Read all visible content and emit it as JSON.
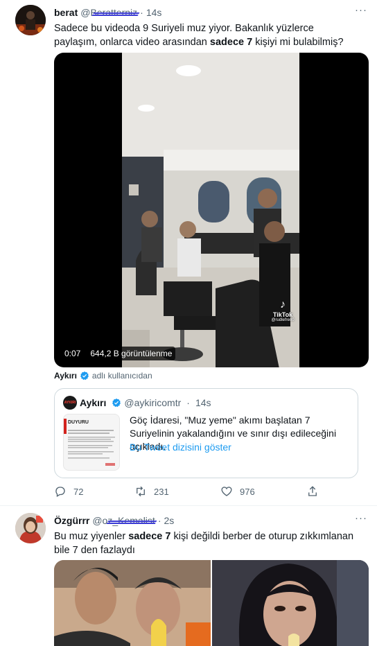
{
  "tweet1": {
    "name": "berat",
    "handle": "@Beratterniz",
    "dot": "·",
    "time": "14s",
    "more": "···",
    "text_part1": "Sadece bu videoda 9 Suriyeli muz yiyor. Bakanlık yüzlerce paylaşım, onlarca video arasından ",
    "text_bold": "sadece 7",
    "text_part2": " kişiyi mi bulabilmiş?",
    "video": {
      "time": "0:07",
      "views": "644,2 B görüntülenme",
      "tiktok_label": "TikTok",
      "tiktok_handle": "@rudlefren0"
    },
    "from_name": "Aykırı",
    "from_suffix": "adlı kullanıcıdan",
    "quote": {
      "avatar_text": "AYKIRI",
      "name": "Aykırı",
      "handle": "@aykiricomtr",
      "dot": "·",
      "time": "14s",
      "thumb_title": "DUYURU",
      "text": "Göç İdaresi, \"Muz yeme\" akımı başlatan 7 Suriyelinin yakalandığını ve sınır dışı edileceğini açıkladı.",
      "link": "Bu Tweet dizisini göster"
    },
    "actions": {
      "replies": "72",
      "retweets": "231",
      "likes": "976"
    }
  },
  "tweet2": {
    "name": "Özgürrr",
    "handle": "@oz_Kemalist",
    "dot": "·",
    "time": "2s",
    "more": "···",
    "text_part1": "Bu muz yiyenler ",
    "text_bold": "sadece 7",
    "text_part2": " kişi değildi  berber de oturup zıkkımlanan bile 7 den fazlaydı"
  },
  "colors": {
    "accent": "#1d9bf0",
    "secondary_text": "#536471",
    "border": "#cfd9de"
  }
}
